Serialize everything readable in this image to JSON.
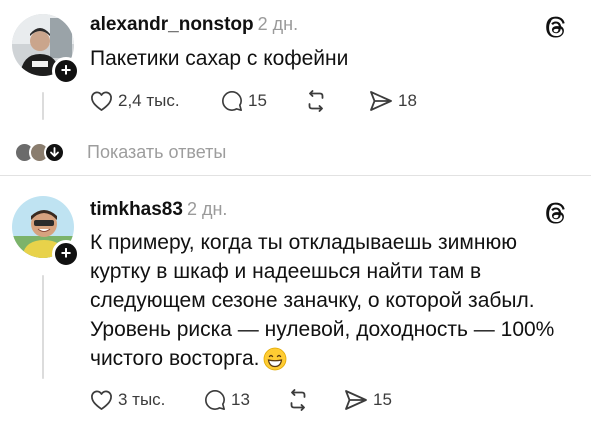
{
  "posts": [
    {
      "username": "alexandr_nonstop",
      "time": "2 дн.",
      "lines": [
        "Пакетики сахар с  кофейни"
      ],
      "likes": "2,4 тыс.",
      "comments": "15",
      "reposts": "",
      "shares": "18",
      "avatar_icon": "person-avatar",
      "more_replies_label": "Показать ответы"
    },
    {
      "username": "timkhas83",
      "time": "2 дн.",
      "lines": [
        "К примеру, когда ты откладываешь зимнюю",
        "куртку в шкаф и надеешься найти там в",
        "следующем сезоне заначку, о которой забыл.",
        "Уровень риска — нулевой, доходность — 100%",
        "чистого восторга."
      ],
      "emoji": "grinning-face-emoji",
      "likes": "3 тыс.",
      "comments": "13",
      "reposts": "",
      "shares": "15",
      "avatar_icon": "person-avatar"
    }
  ],
  "icons": {
    "like": "heart-icon",
    "comment": "comment-bubble-icon",
    "repost": "repost-arrows-icon",
    "share": "send-icon",
    "app": "threads-logo-icon",
    "follow": "plus-icon"
  },
  "colors": {
    "text": "#111111",
    "muted": "#9a9a9a",
    "divider": "#e2e2e2"
  }
}
